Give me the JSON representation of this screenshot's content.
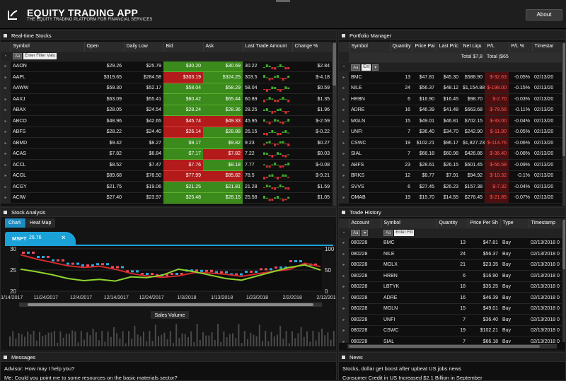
{
  "header": {
    "title": "EQUITY TRADING APP",
    "subtitle": "THE EQUITY TRADING PLATFORM FOR FINANCIAL SERVICES",
    "about": "About"
  },
  "realtime": {
    "title": "Real-time Stocks",
    "filter_abbr": "Aa",
    "filter_placeholder": "Enter Filter Valu",
    "columns": [
      "Symbol",
      "Open",
      "Daily Low",
      "Bid",
      "Ask",
      "Last Trade Amount",
      "Change %"
    ],
    "rows": [
      {
        "s": "AAON",
        "o": "$29.26",
        "l": "$25.79",
        "b": "$30.20",
        "a": "$30.69",
        "t": "30.22",
        "c": "$2.84",
        "bc": "g",
        "ac": "g"
      },
      {
        "s": "AAPL",
        "o": "$319.65",
        "l": "$284.58",
        "b": "$303.19",
        "a": "$324.25",
        "t": "303.5",
        "c": "$-4.18",
        "bc": "r",
        "ac": "g"
      },
      {
        "s": "AAWW",
        "o": "$59.30",
        "l": "$52.17",
        "b": "$58.04",
        "a": "$58.29",
        "t": "58.04",
        "c": "$0.59",
        "bc": "g",
        "ac": "g"
      },
      {
        "s": "AAXJ",
        "o": "$63.09",
        "l": "$55.41",
        "b": "$60.42",
        "a": "$65.44",
        "t": "60.89",
        "c": "$1.35",
        "bc": "g",
        "ac": "g"
      },
      {
        "s": "ABAX",
        "o": "$28.05",
        "l": "$24.54",
        "b": "$28.24",
        "a": "$28.36",
        "t": "28.25",
        "c": "$1.96",
        "bc": "g",
        "ac": "g"
      },
      {
        "s": "ABCO",
        "o": "$48.96",
        "l": "$42.65",
        "b": "$45.74",
        "a": "$49.33",
        "t": "45.95",
        "c": "$-2.59",
        "bc": "r",
        "ac": "r"
      },
      {
        "s": "ABFS",
        "o": "$28.22",
        "l": "$24.40",
        "b": "$26.14",
        "a": "$28.88",
        "t": "26.15",
        "c": "$-0.22",
        "bc": "r",
        "ac": "g"
      },
      {
        "s": "ABMD",
        "o": "$9.42",
        "l": "$8.27",
        "b": "$9.17",
        "a": "$9.82",
        "t": "9.23",
        "c": "$0.27",
        "bc": "g",
        "ac": "g"
      },
      {
        "s": "ACAS",
        "o": "$7.82",
        "l": "$6.84",
        "b": "$7.17",
        "a": "$7.82",
        "t": "7.22",
        "c": "$0.03",
        "bc": "g",
        "ac": "r"
      },
      {
        "s": "ACCL",
        "o": "$8.52",
        "l": "$7.47",
        "b": "$7.76",
        "a": "$8.18",
        "t": "7.77",
        "c": "$-0.08",
        "bc": "r",
        "ac": "g"
      },
      {
        "s": "ACGL",
        "o": "$89.68",
        "l": "$78.50",
        "b": "$77.99",
        "a": "$85.82",
        "t": "78.5",
        "c": "$-9.21",
        "bc": "r",
        "ac": "r"
      },
      {
        "s": "ACGY",
        "o": "$21.75",
        "l": "$19.06",
        "b": "$21.25",
        "a": "$21.81",
        "t": "21.28",
        "c": "$1.59",
        "bc": "g",
        "ac": "g"
      },
      {
        "s": "ACIW",
        "o": "$27.40",
        "l": "$23.97",
        "b": "$25.48",
        "a": "$28.15",
        "t": "25.58",
        "c": "$1.05",
        "bc": "g",
        "ac": "g"
      }
    ]
  },
  "portfolio": {
    "title": "Portfolio Manager",
    "filter_abbr": "Aa",
    "filter_placeholder": "Ent",
    "columns": [
      "Symbol",
      "Quantity",
      "Price Pai",
      "Last Pric",
      "Net Liqu",
      "P/L",
      "P/L %",
      "Timestar"
    ],
    "total_row": [
      "Total $7,8",
      "Total ($65"
    ],
    "rows": [
      [
        "BMC",
        "13",
        "$47.81",
        "$45.30",
        "$588.90",
        "$-32.63",
        "-0.05%",
        "02/13/20"
      ],
      [
        "NILE",
        "24",
        "$56.37",
        "$48.12",
        "$1,154.88",
        "$-198.00",
        "-0.15%",
        "02/13/20"
      ],
      [
        "HRBN",
        "6",
        "$16.90",
        "$16.45",
        "$98.70",
        "$-2.70",
        "-0.03%",
        "02/13/20"
      ],
      [
        "ADRE",
        "16",
        "$46.39",
        "$41.48",
        "$663.68",
        "$-78.56",
        "-0.11%",
        "02/13/20"
      ],
      [
        "MGLN",
        "15",
        "$49.01",
        "$46.81",
        "$702.15",
        "$-33.00",
        "-0.04%",
        "02/13/20"
      ],
      [
        "UNFI",
        "7",
        "$36.40",
        "$34.70",
        "$242.90",
        "$-11.90",
        "-0.05%",
        "02/13/20"
      ],
      [
        "CSWC",
        "19",
        "$102.21",
        "$96.17",
        "$1,827.23",
        "$-114.76",
        "-0.06%",
        "02/13/20"
      ],
      [
        "SIAL",
        "7",
        "$66.18",
        "$60.98",
        "$426.86",
        "$-36.40",
        "-0.08%",
        "02/13/20"
      ],
      [
        "ABFS",
        "23",
        "$28.61",
        "$26.15",
        "$601.45",
        "$-56.58",
        "-0.09%",
        "02/13/20"
      ],
      [
        "BRKS",
        "12",
        "$8.77",
        "$7.91",
        "$94.92",
        "$-10.32",
        "-0.1%",
        "02/13/20"
      ],
      [
        "SVVS",
        "6",
        "$27.45",
        "$26.23",
        "$157.38",
        "$-7.32",
        "-0.04%",
        "02/13/20"
      ],
      [
        "OMAB",
        "19",
        "$15.70",
        "$14.55",
        "$276.45",
        "$-21.85",
        "-0.07%",
        "02/13/20"
      ]
    ]
  },
  "analysis": {
    "title": "Stock Analysis",
    "tabs": [
      "Chart",
      "Heat Map"
    ],
    "ticker": "MSFT",
    "price": "26.76",
    "close": "×",
    "volume_label": "Sales Volume"
  },
  "chart_data": {
    "type": "line",
    "title": "",
    "xlabel": "",
    "ylabel": "",
    "x": [
      "11/14/2017",
      "11/24/2017",
      "12/4/2017",
      "12/14/2017",
      "12/24/2017",
      "1/3/2018",
      "1/13/2018",
      "1/23/2018",
      "2/2/2018",
      "2/12/2018"
    ],
    "yticks_left": [
      "30",
      "25",
      "20"
    ],
    "yticks_right": [
      "100",
      "50",
      "0"
    ],
    "ylim_left": [
      20,
      30
    ],
    "ylim_right": [
      0,
      100
    ],
    "series": [
      {
        "values": [
          28.6,
          27.6,
          26.8,
          26.0,
          25.6,
          25.9,
          25.2,
          24.2,
          23.6,
          23.3,
          23.6,
          24.4,
          24.3,
          24.0,
          23.5,
          24.1,
          24.7,
          25.1,
          26.6,
          25.8
        ]
      },
      {
        "values": [
          25.2,
          24.6,
          23.9,
          23.0,
          22.5,
          22.8,
          22.4,
          23.4,
          23.2,
          23.8,
          25.2,
          24.6,
          23.8,
          23.0,
          22.6,
          23.6,
          24.6,
          25.6,
          26.2,
          25.0
        ]
      }
    ]
  },
  "trades": {
    "title": "Trade History",
    "filter_abbr": "Aa",
    "filter_placeholder": "Enter Filt",
    "columns": [
      "Account",
      "Symbol",
      "Quantity",
      "Price Per Sh",
      "Type",
      "Timestamp"
    ],
    "rows": [
      [
        "080228",
        "BMC",
        "13",
        "$47.81",
        "Buy",
        "02/13/2018 0"
      ],
      [
        "080228",
        "NILE",
        "24",
        "$56.37",
        "Buy",
        "02/13/2018 0"
      ],
      [
        "080228",
        "MOLX",
        "21",
        "$23.35",
        "Buy",
        "02/13/2018 0"
      ],
      [
        "080228",
        "HRBN",
        "6",
        "$16.90",
        "Buy",
        "02/13/2018 0"
      ],
      [
        "080228",
        "LBTYK",
        "18",
        "$35.25",
        "Buy",
        "02/13/2018 0"
      ],
      [
        "080228",
        "ADRE",
        "16",
        "$46.39",
        "Buy",
        "02/13/2018 0"
      ],
      [
        "080228",
        "MGLN",
        "15",
        "$49.01",
        "Buy",
        "02/13/2018 0"
      ],
      [
        "080228",
        "UNFI",
        "7",
        "$36.40",
        "Buy",
        "02/13/2018 0"
      ],
      [
        "080228",
        "CSWC",
        "19",
        "$102.21",
        "Buy",
        "02/13/2018 0"
      ],
      [
        "080228",
        "SIAL",
        "7",
        "$66.18",
        "Buy",
        "02/13/2018 0"
      ]
    ]
  },
  "messages": {
    "title": "Messages",
    "lines": [
      "Advisor: How may I help you?",
      "Me: Could you point me to some resources on the basic materials sector?"
    ]
  },
  "news": {
    "title": "News",
    "lines": [
      "Stocks, dollar get boost after upbeat US jobs news",
      "Consumer Credit in US Increased $2.1 Billion in September"
    ]
  }
}
